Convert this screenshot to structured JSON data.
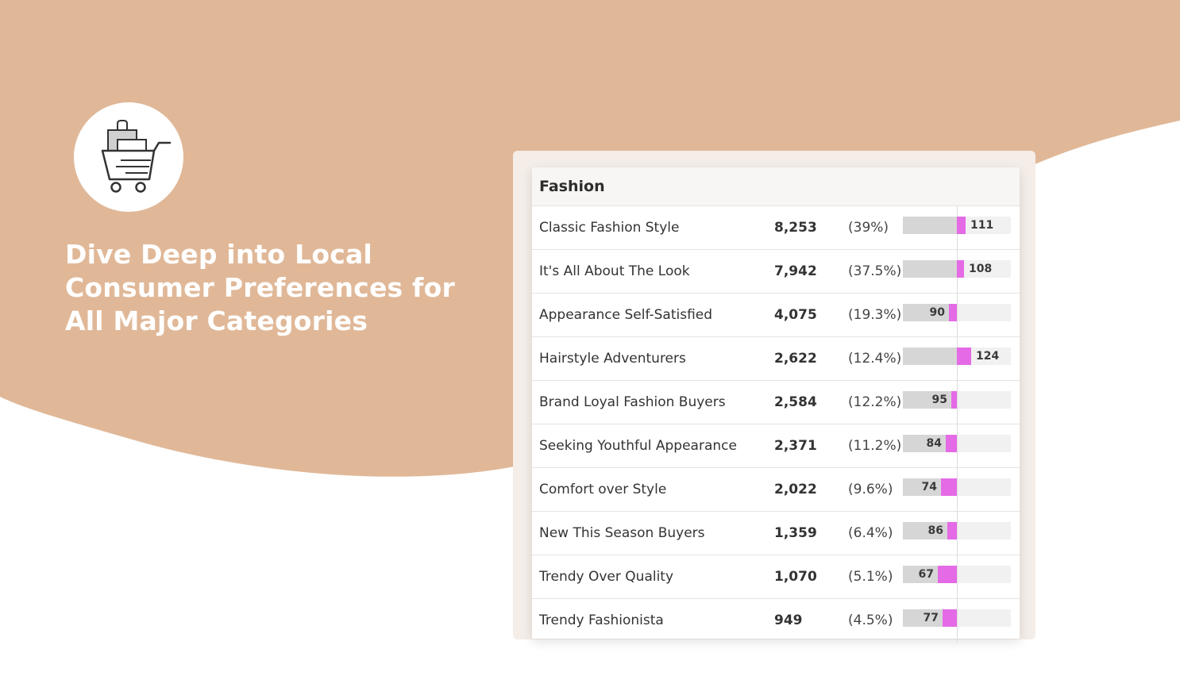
{
  "hero": {
    "headline": "Dive Deep into Local Consumer Preferences for All Major Categories",
    "icon": "shopping-cart-icon"
  },
  "colors": {
    "background_blob": "#e0b898",
    "index_bar": "#e46ae6",
    "base_bar": "#d6d6d6"
  },
  "table": {
    "title": "Fashion",
    "rows": [
      {
        "name": "Classic Fashion Style",
        "count": "8,253",
        "pct": "(39%)",
        "index": 111
      },
      {
        "name": "It's All About The Look",
        "count": "7,942",
        "pct": "(37.5%)",
        "index": 108
      },
      {
        "name": "Appearance Self-Satisfied",
        "count": "4,075",
        "pct": "(19.3%)",
        "index": 90
      },
      {
        "name": "Hairstyle Adventurers",
        "count": "2,622",
        "pct": "(12.4%)",
        "index": 124
      },
      {
        "name": "Brand Loyal Fashion Buyers",
        "count": "2,584",
        "pct": "(12.2%)",
        "index": 95
      },
      {
        "name": "Seeking Youthful Appearance",
        "count": "2,371",
        "pct": "(11.2%)",
        "index": 84
      },
      {
        "name": "Comfort over Style",
        "count": "2,022",
        "pct": "(9.6%)",
        "index": 74
      },
      {
        "name": "New This Season Buyers",
        "count": "1,359",
        "pct": "(6.4%)",
        "index": 86
      },
      {
        "name": "Trendy Over Quality",
        "count": "1,070",
        "pct": "(5.1%)",
        "index": 67
      },
      {
        "name": "Trendy Fashionista",
        "count": "949",
        "pct": "(4.5%)",
        "index": 77
      }
    ]
  }
}
